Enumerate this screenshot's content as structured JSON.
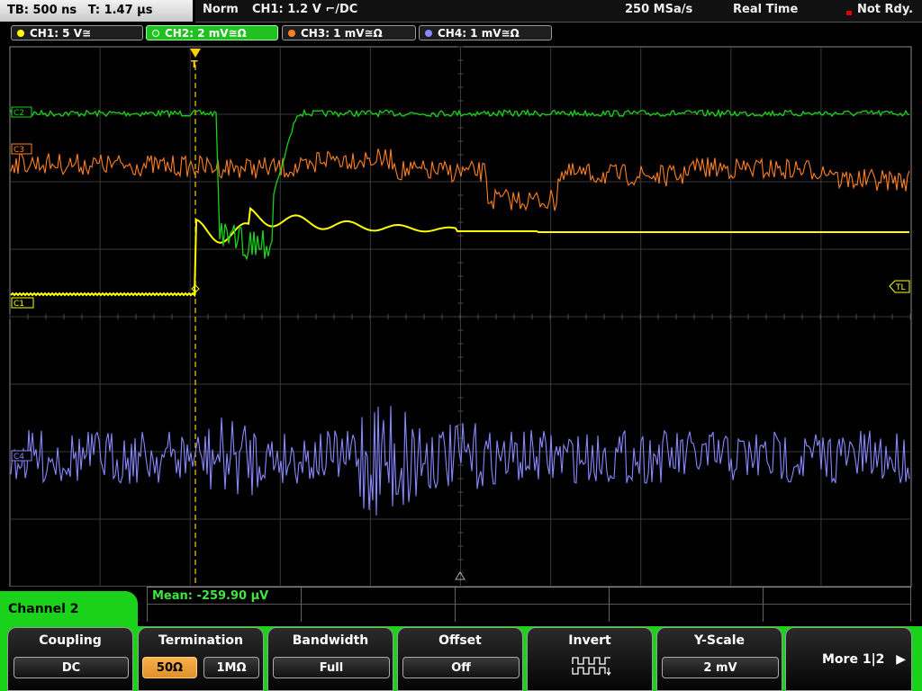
{
  "status": {
    "timebase": "TB: 500 ns",
    "trigger_time": "T: 1.47 µs",
    "trigger_mode": "Norm",
    "trigger_source": "CH1: 1.2 V ⌐/DC",
    "sample_rate": "250 MSa/s",
    "acq_mode": "Real Time",
    "ready_state": "Not Rdy."
  },
  "channels": [
    {
      "label": "CH1: 5 V≅",
      "color": "#ffff00"
    },
    {
      "label": "CH2: 2 mV≅Ω",
      "color": "#19d219"
    },
    {
      "label": "CH3: 1 mV≅Ω",
      "color": "#ff8020"
    },
    {
      "label": "CH4: 1 mV≅Ω",
      "color": "#8888ff"
    }
  ],
  "markers": {
    "ch2": "C2",
    "ch3": "C3",
    "ch1": "C1",
    "ch4": "C4",
    "trigger_level": "TL",
    "trigger_pos": "T"
  },
  "measurement": {
    "label": "Mean: -259.90 µV"
  },
  "menu": {
    "channel": "Channel 2",
    "coupling": {
      "title": "Coupling",
      "value": "DC"
    },
    "termination": {
      "title": "Termination",
      "opt1": "50Ω",
      "opt2": "1MΩ"
    },
    "bandwidth": {
      "title": "Bandwidth",
      "value": "Full"
    },
    "offset": {
      "title": "Offset",
      "value": "Off"
    },
    "invert": {
      "title": "Invert"
    },
    "yscale": {
      "title": "Y-Scale",
      "value": "2 mV"
    },
    "more": {
      "label": "More 1|2"
    }
  },
  "colors": {
    "ch1": "#ffff00",
    "ch2": "#19d219",
    "ch3": "#ff8020",
    "ch4": "#8888ff",
    "grid": "#3a3a3a",
    "trigger": "#ffd000"
  }
}
